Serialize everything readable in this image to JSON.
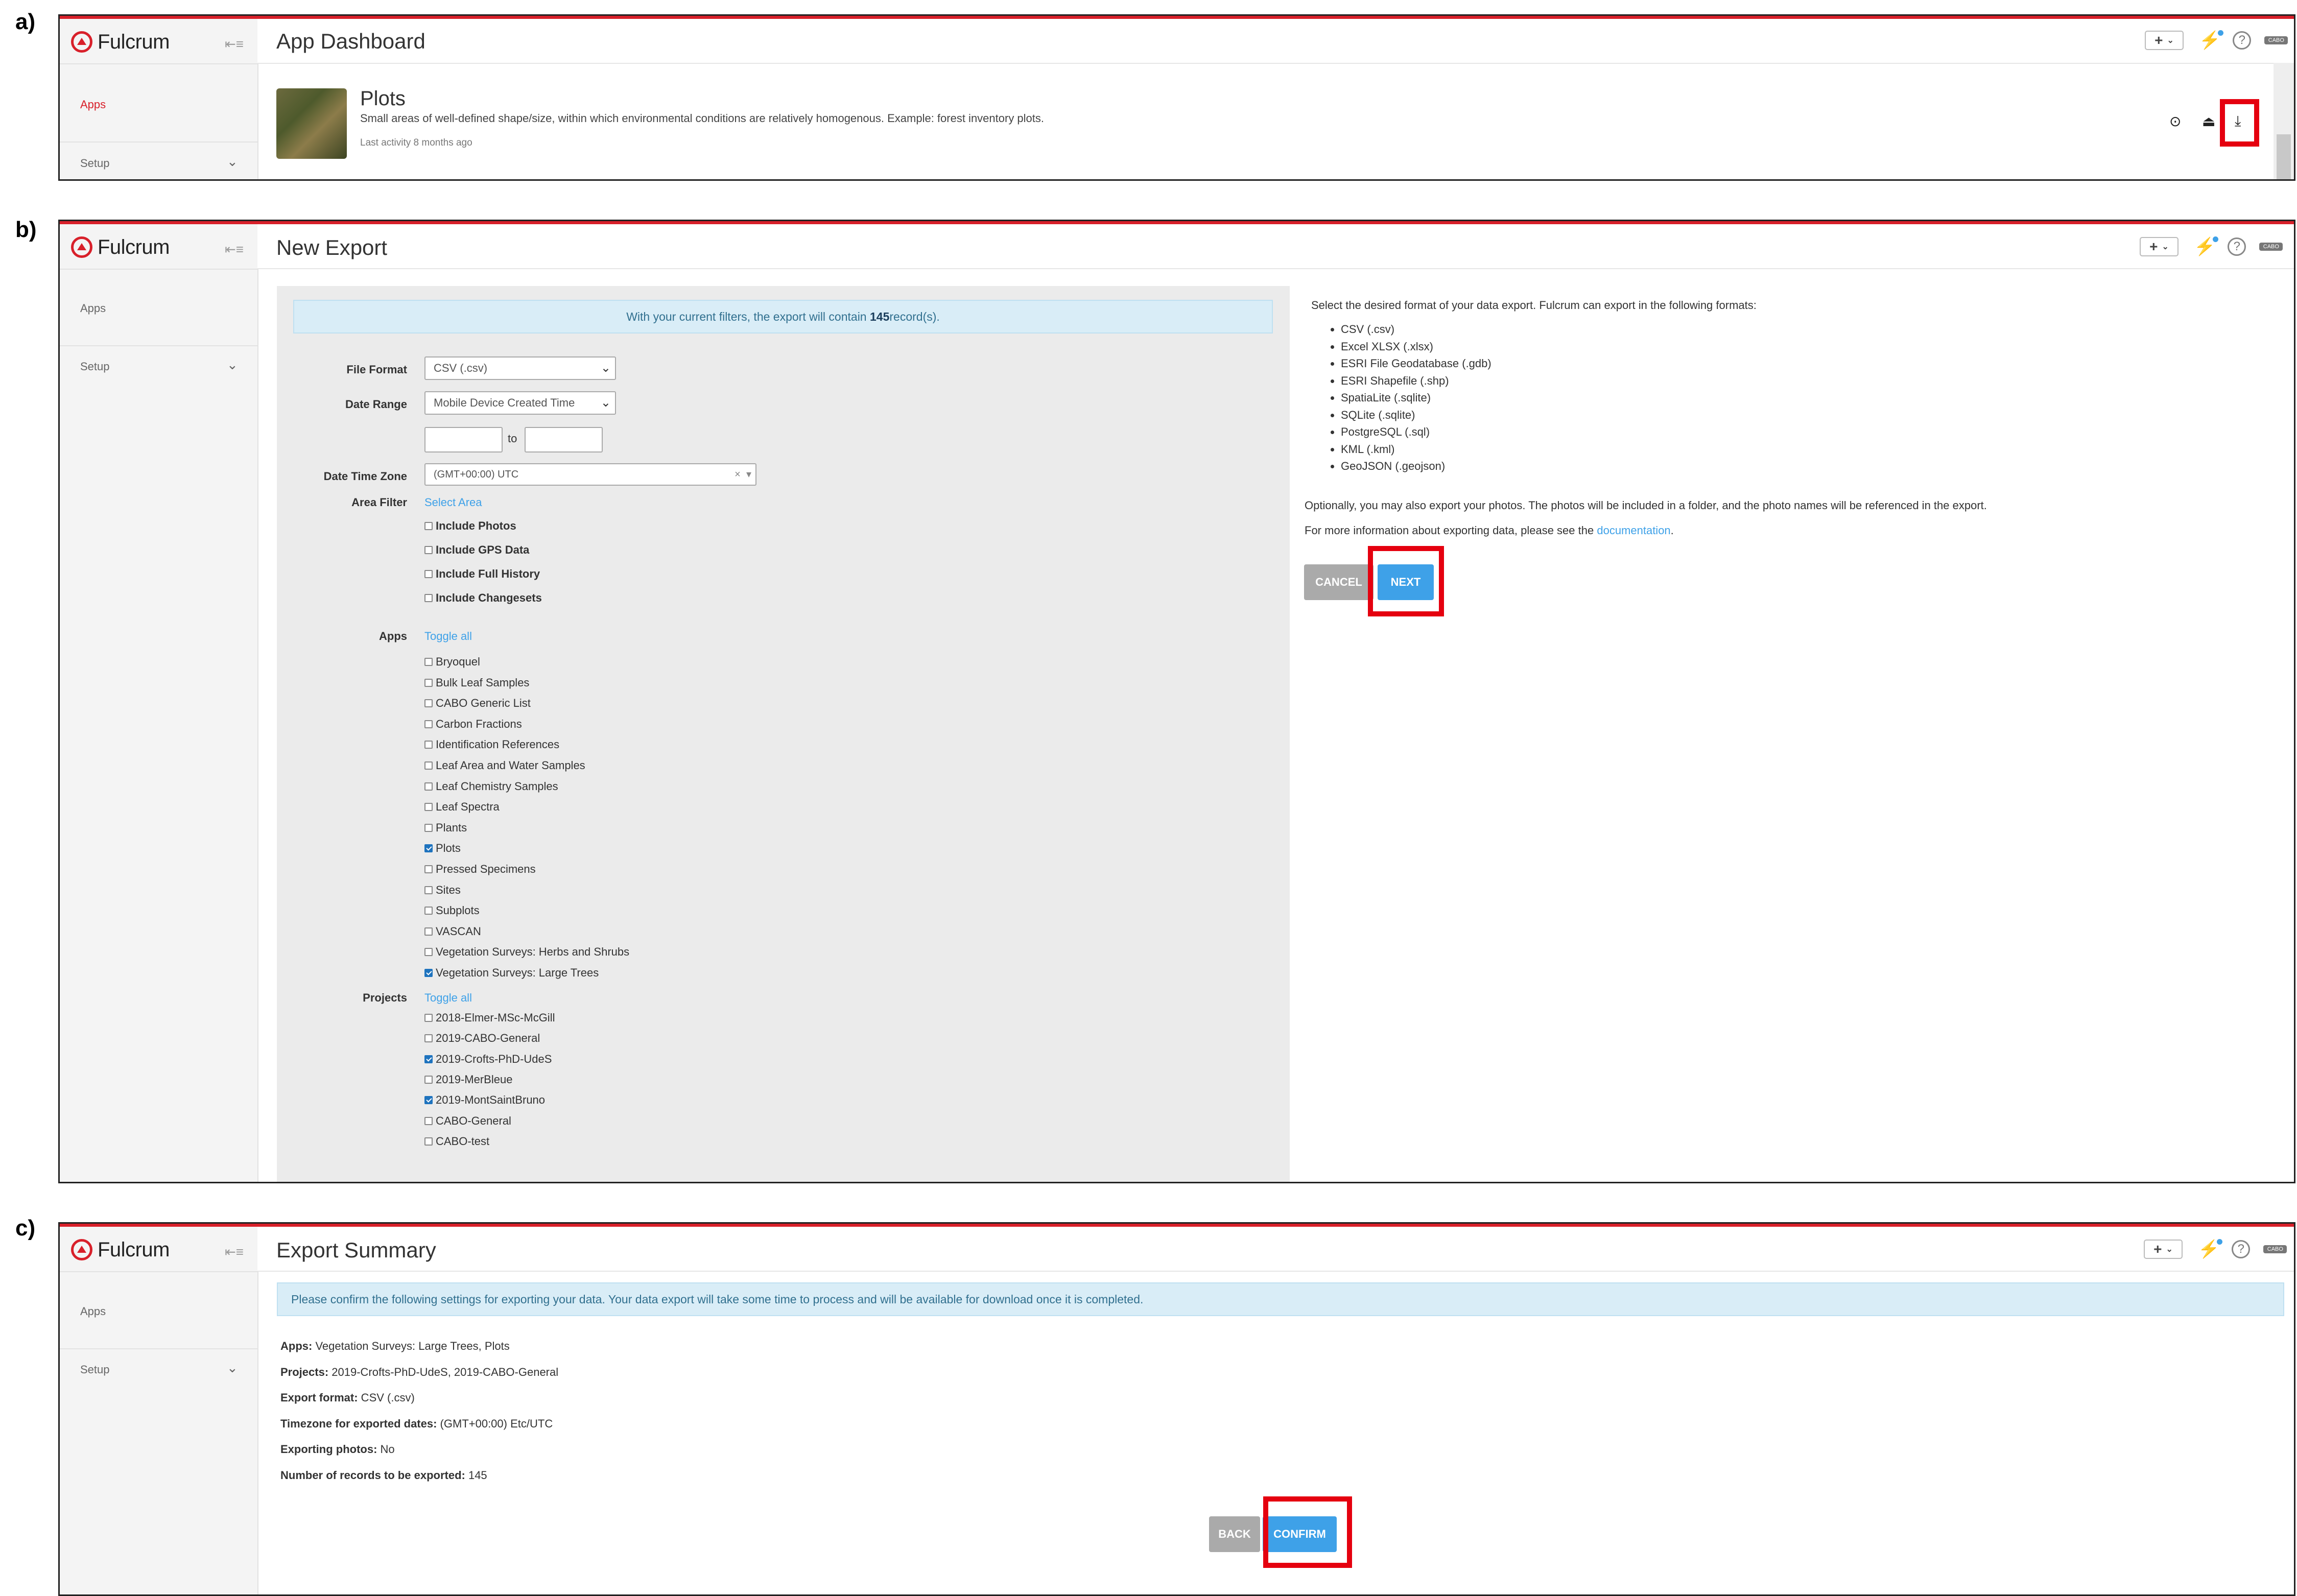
{
  "panel_labels": {
    "a": "a)",
    "b": "b)",
    "c": "c)"
  },
  "brand": {
    "name": "Fulcrum",
    "accent": "#d8202a",
    "link": "#3ea1e8",
    "icon": "fulcrum-logo-icon"
  },
  "header_actions": {
    "plus": "+",
    "help": "?",
    "avatar": "CABO"
  },
  "sidebar": {
    "apps": "Apps",
    "setup": "Setup"
  },
  "panel_a": {
    "title": "App Dashboard",
    "app": {
      "name": "Plots",
      "description": "Small areas of well-defined shape/size, within which environmental conditions are relatively homogenous. Example: forest inventory plots.",
      "activity": "Last activity 8 months ago"
    },
    "row_icons": [
      "map-pin-icon",
      "upload-icon",
      "download-icon"
    ]
  },
  "panel_b": {
    "title": "New Export",
    "banner_prefix": "With your current filters, the export will contain ",
    "banner_count": "145",
    "banner_suffix": " record(s).",
    "labels": {
      "file_format": "File Format",
      "date_range": "Date Range",
      "date_time_zone": "Date Time Zone",
      "area_filter": "Area Filter",
      "apps": "Apps",
      "projects": "Projects",
      "to": "to"
    },
    "file_format_value": "CSV (.csv)",
    "date_range_value": "Mobile Device Created Time",
    "timezone_value": "(GMT+00:00) UTC",
    "select_area": "Select Area",
    "toggle_all": "Toggle all",
    "options": [
      {
        "label": "Include Photos",
        "checked": false
      },
      {
        "label": "Include GPS Data",
        "checked": false
      },
      {
        "label": "Include Full History",
        "checked": false
      },
      {
        "label": "Include Changesets",
        "checked": false
      }
    ],
    "apps": [
      {
        "label": "Bryoquel",
        "checked": false
      },
      {
        "label": "Bulk Leaf Samples",
        "checked": false
      },
      {
        "label": "CABO Generic List",
        "checked": false
      },
      {
        "label": "Carbon Fractions",
        "checked": false
      },
      {
        "label": "Identification References",
        "checked": false
      },
      {
        "label": "Leaf Area and Water Samples",
        "checked": false
      },
      {
        "label": "Leaf Chemistry Samples",
        "checked": false
      },
      {
        "label": "Leaf Spectra",
        "checked": false
      },
      {
        "label": "Plants",
        "checked": false
      },
      {
        "label": "Plots",
        "checked": true
      },
      {
        "label": "Pressed Specimens",
        "checked": false
      },
      {
        "label": "Sites",
        "checked": false
      },
      {
        "label": "Subplots",
        "checked": false
      },
      {
        "label": "VASCAN",
        "checked": false
      },
      {
        "label": "Vegetation Surveys: Herbs and Shrubs",
        "checked": false
      },
      {
        "label": "Vegetation Surveys: Large Trees",
        "checked": true
      }
    ],
    "projects": [
      {
        "label": "2018-Elmer-MSc-McGill",
        "checked": false
      },
      {
        "label": "2019-CABO-General",
        "checked": false
      },
      {
        "label": "2019-Crofts-PhD-UdeS",
        "checked": true
      },
      {
        "label": "2019-MerBleue",
        "checked": false
      },
      {
        "label": "2019-MontSaintBruno",
        "checked": true
      },
      {
        "label": "CABO-General",
        "checked": false
      },
      {
        "label": "CABO-test",
        "checked": false
      }
    ],
    "right": {
      "intro": "Select the desired format of your data export. Fulcrum can export in the following formats:",
      "formats": [
        "CSV (.csv)",
        "Excel XLSX (.xlsx)",
        "ESRI File Geodatabase (.gdb)",
        "ESRI Shapefile (.shp)",
        "SpatiaLite (.sqlite)",
        "SQLite (.sqlite)",
        "PostgreSQL (.sql)",
        "KML (.kml)",
        "GeoJSON (.geojson)"
      ],
      "photos_note": "Optionally, you may also export your photos. The photos will be included in a folder, and the photo names will be referenced in the export.",
      "docs_prefix": "For more information about exporting data, please see the ",
      "docs_link": "documentation",
      "docs_suffix": ".",
      "cancel": "Cancel",
      "next": "Next"
    }
  },
  "panel_c": {
    "title": "Export Summary",
    "banner": "Please confirm the following settings for exporting your data. Your data export will take some time to process and will be available for download once it is completed.",
    "rows": [
      {
        "label": "Apps:",
        "value": "Vegetation Surveys: Large Trees, Plots"
      },
      {
        "label": "Projects:",
        "value": "2019-Crofts-PhD-UdeS, 2019-CABO-General"
      },
      {
        "label": "Export format:",
        "value": "CSV (.csv)"
      },
      {
        "label": "Timezone for exported dates:",
        "value": "(GMT+00:00) Etc/UTC"
      },
      {
        "label": "Exporting photos:",
        "value": "No"
      },
      {
        "label": "Number of records to be exported:",
        "value": "145"
      }
    ],
    "back": "Back",
    "confirm": "Confirm"
  }
}
